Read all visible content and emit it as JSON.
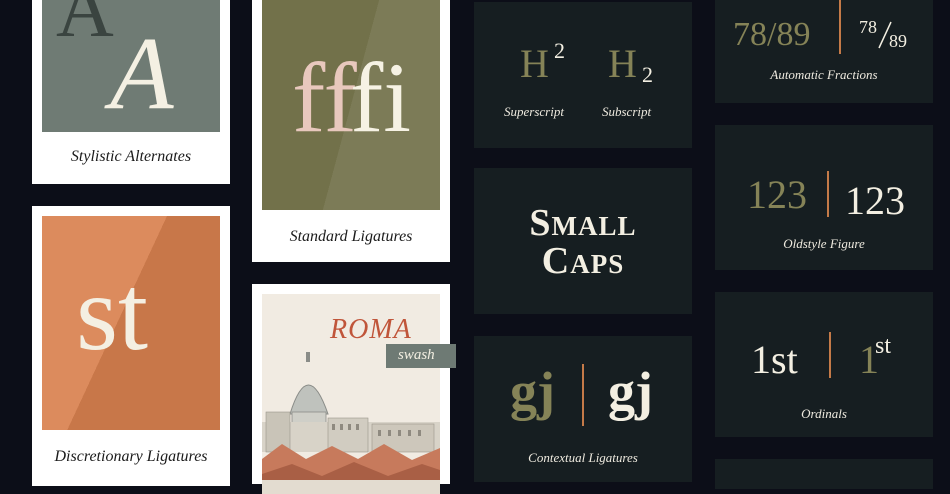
{
  "cards": {
    "stylistic": {
      "caption": "Stylistic Alternates",
      "glyph_back": "A",
      "glyph_front": "A",
      "color": "#6f7b74"
    },
    "standard": {
      "caption": "Standard Ligatures",
      "glyph_left": "ff",
      "glyph_right": "fi",
      "color": "#72714a"
    },
    "discretionary": {
      "caption": "Discretionary Ligatures",
      "glyph": "st",
      "color": "#d9814f"
    },
    "roma": {
      "title": "ROMA",
      "tag": "swash"
    }
  },
  "panels": {
    "superscript": {
      "base": "H",
      "sup": "2",
      "label": "Superscript"
    },
    "subscript": {
      "base": "H",
      "sub": "2",
      "label": "Subscript"
    },
    "smallcaps": {
      "line1": "Small",
      "line2": "Caps"
    },
    "contextual": {
      "left": "gj",
      "right": "gj",
      "label": "Contextual Ligatures"
    },
    "fractions": {
      "plain": "78/89",
      "num": "78",
      "den": "89",
      "label": "Automatic Fractions"
    },
    "oldstyle": {
      "left": "123",
      "right": "123",
      "label": "Oldstyle Figure"
    },
    "ordinals": {
      "left": "1st",
      "num": "1",
      "sup": "st",
      "label": "Ordinals"
    }
  }
}
